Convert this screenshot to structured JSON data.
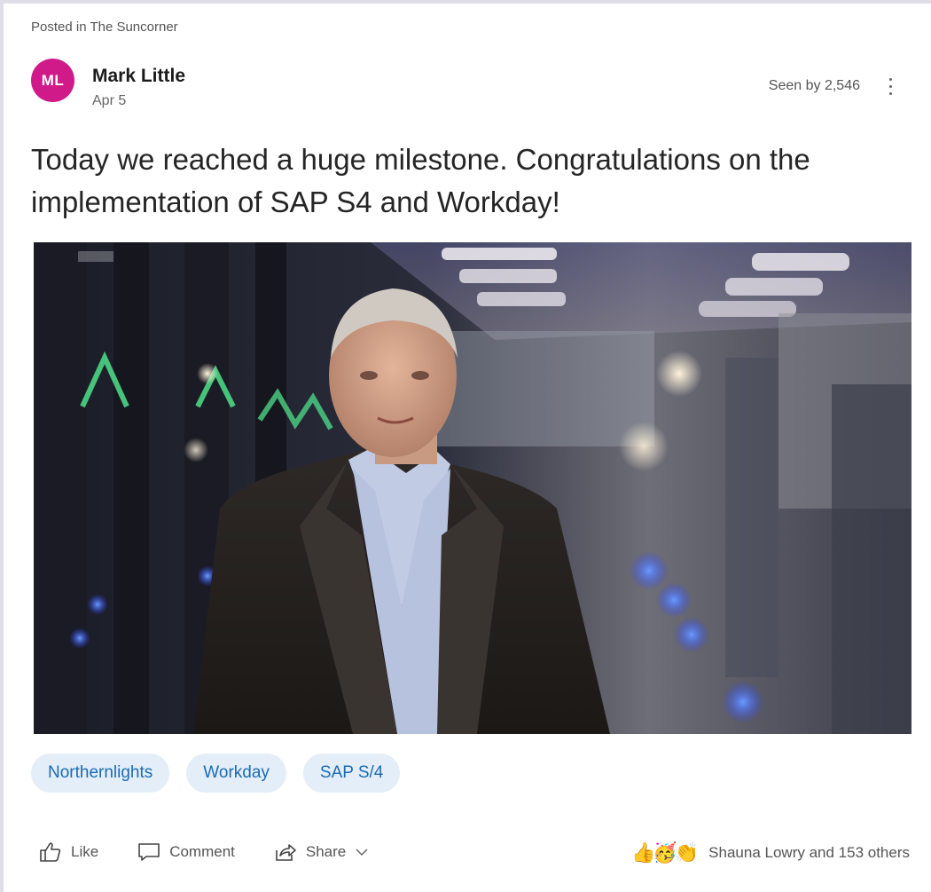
{
  "post": {
    "community": "Posted in The Suncorner",
    "author_initials": "ML",
    "author_name": "Mark Little",
    "date": "Apr 5",
    "seen_by": "Seen by 2,546",
    "message": "Today we reached a huge milestone. Congratulations on the implementation of SAP S4 and Workday!",
    "tags": [
      "Northernlights",
      "Workday",
      "SAP S/4"
    ],
    "actions": {
      "like": "Like",
      "comment": "Comment",
      "share": "Share"
    },
    "reactions": {
      "icons": [
        "👍",
        "🥳",
        "👏"
      ],
      "summary": "Shauna Lowry and 153 others"
    }
  },
  "colors": {
    "avatar_bg": "#d11a8a",
    "tag_bg": "#e3eef9",
    "tag_text": "#1b6bb3"
  }
}
